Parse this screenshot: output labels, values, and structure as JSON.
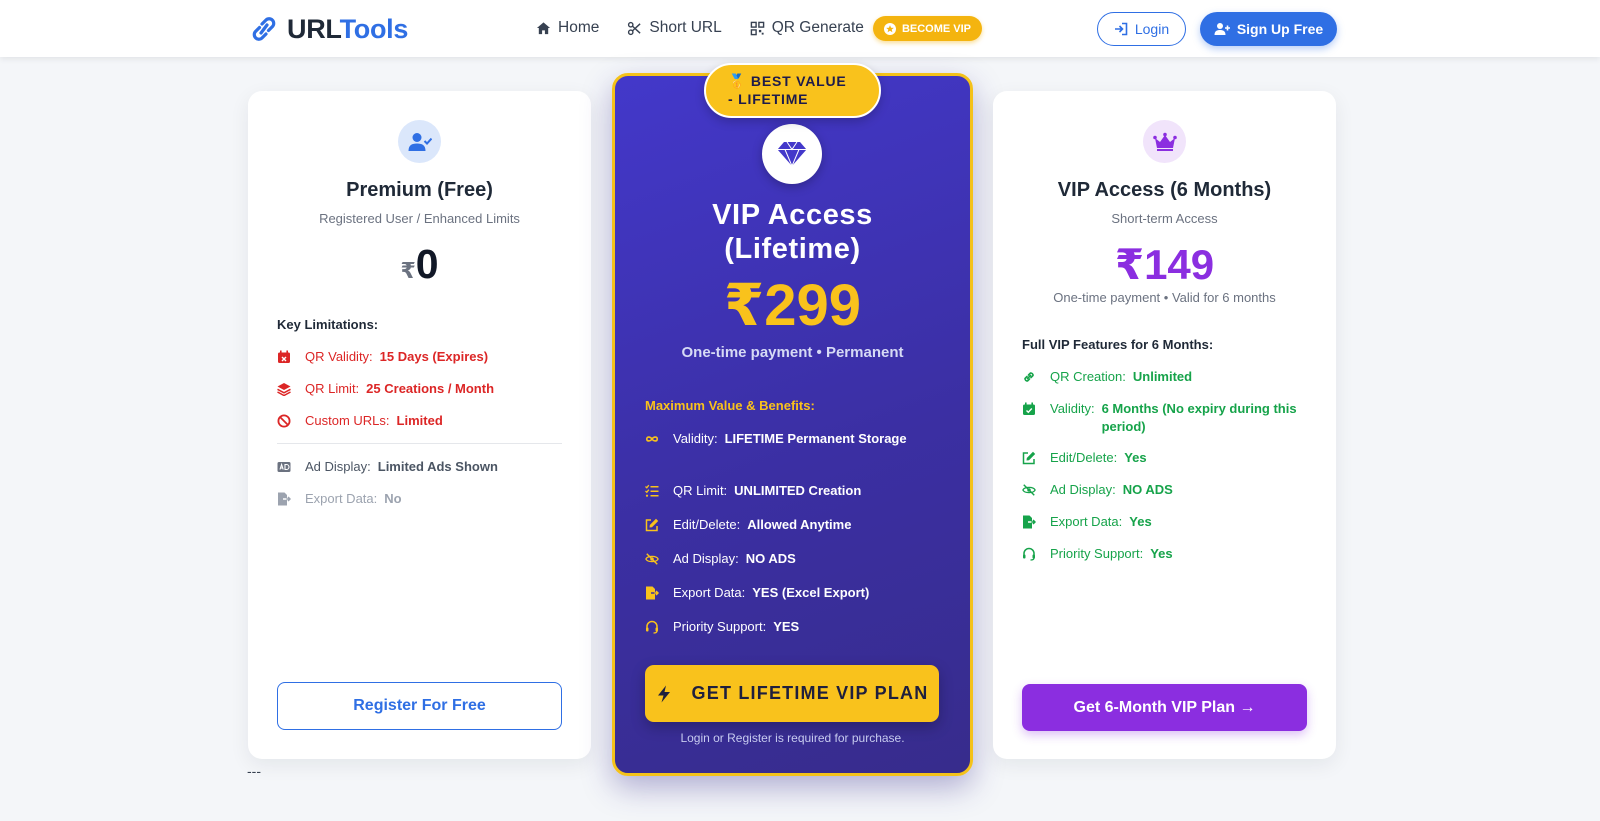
{
  "navbar": {
    "brand_part1": "URL",
    "brand_part2": "Tools",
    "links": [
      "Home",
      "Short URL",
      "QR Generate"
    ],
    "vip_pill": "BECOME VIP",
    "login": "Login",
    "signup": "Sign Up Free"
  },
  "plans": {
    "free": {
      "title": "Premium (Free)",
      "subtitle": "Registered User / Enhanced Limits",
      "currency": "₹",
      "price": "0",
      "features_heading": "Key Limitations:",
      "limitations": [
        {
          "icon": "calendar-x-icon",
          "label": "QR Validity:",
          "value": "15 Days (Expires)"
        },
        {
          "icon": "layers-icon",
          "label": "QR Limit:",
          "value": "25 Creations / Month"
        },
        {
          "icon": "ban-icon",
          "label": "Custom URLs:",
          "value": "Limited"
        }
      ],
      "extras": [
        {
          "icon": "ad-icon",
          "label": "Ad Display:",
          "value": "Limited Ads Shown"
        },
        {
          "icon": "file-export-icon",
          "label": "Export Data:",
          "value": "No"
        }
      ],
      "button": "Register For Free"
    },
    "lifetime": {
      "ribbon_line1": "🥇 BEST VALUE",
      "ribbon_line2": "- LIFETIME",
      "title_line1": "VIP Access",
      "title_line2": "(Lifetime)",
      "price": "₹299",
      "price_note": "One-time payment • Permanent",
      "features_heading": "Maximum Value & Benefits:",
      "features": [
        {
          "icon": "infinity-icon",
          "label": "Validity:",
          "value": "LIFETIME Permanent Storage"
        },
        {
          "icon": "list-check-icon",
          "label": "QR Limit:",
          "value": "UNLIMITED Creation"
        },
        {
          "icon": "edit-icon",
          "label": "Edit/Delete:",
          "value": "Allowed Anytime"
        },
        {
          "icon": "eye-slash-icon",
          "label": "Ad Display:",
          "value": "NO ADS"
        },
        {
          "icon": "file-export-icon",
          "label": "Export Data:",
          "value": "YES (Excel Export)"
        },
        {
          "icon": "headset-icon",
          "label": "Priority Support:",
          "value": "YES"
        }
      ],
      "button": "GET LIFETIME VIP PLAN",
      "footnote": "Login or Register is required for purchase."
    },
    "six_month": {
      "title": "VIP Access (6 Months)",
      "subtitle": "Short-term Access",
      "price": "₹149",
      "price_note": "One-time payment • Valid for 6 months",
      "features_heading": "Full VIP Features for 6 Months:",
      "features": [
        {
          "icon": "link-icon",
          "label": "QR Creation:",
          "value": "Unlimited"
        },
        {
          "icon": "calendar-check-icon",
          "label": "Validity:",
          "value": "6 Months (No expiry during this period)"
        },
        {
          "icon": "edit-icon",
          "label": "Edit/Delete:",
          "value": "Yes"
        },
        {
          "icon": "eye-slash-icon",
          "label": "Ad Display:",
          "value": "NO ADS"
        },
        {
          "icon": "file-export-icon",
          "label": "Export Data:",
          "value": "Yes"
        },
        {
          "icon": "headset-icon",
          "label": "Priority Support:",
          "value": "Yes"
        }
      ],
      "button": "Get 6-Month VIP Plan →"
    }
  },
  "footer_text": "---",
  "colors": {
    "brand_blue": "#2f6fe4",
    "gold": "#f9c21c",
    "purple": "#8b2ee0",
    "red": "#dc2626",
    "green": "#16a34a",
    "indigo": "#4338ca"
  }
}
